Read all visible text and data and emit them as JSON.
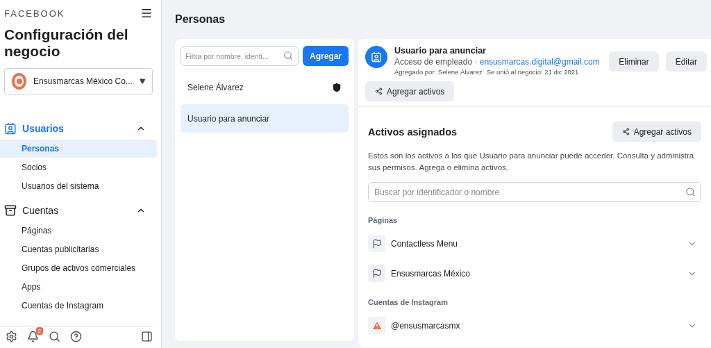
{
  "sidebar": {
    "brand": "FACEBOOK",
    "title": "Configuración del negocio",
    "business": "Ensusmarcas México Co...",
    "sections": [
      {
        "label": "Usuarios",
        "kind": "users",
        "selected": true,
        "expanded": true,
        "items": [
          {
            "label": "Personas",
            "selected": true
          },
          {
            "label": "Socios",
            "selected": false
          },
          {
            "label": "Usuarios del sistema",
            "selected": false
          }
        ]
      },
      {
        "label": "Cuentas",
        "kind": "accounts",
        "selected": false,
        "expanded": true,
        "items": [
          {
            "label": "Páginas",
            "selected": false
          },
          {
            "label": "Cuentas publicitarias",
            "selected": false
          },
          {
            "label": "Grupos de activos comerciales",
            "selected": false
          },
          {
            "label": "Apps",
            "selected": false
          },
          {
            "label": "Cuentas de Instagram",
            "selected": false
          }
        ]
      }
    ],
    "notification_count": "2"
  },
  "page_title": "Personas",
  "people": {
    "filter_placeholder": "Filtra por nombre, identi...",
    "add_button": "Agregar",
    "rows": [
      {
        "name": "Selene Álvarez",
        "admin": true,
        "selected": false
      },
      {
        "name": "Usuario para anunciar",
        "admin": false,
        "selected": true
      }
    ]
  },
  "detail": {
    "name": "Usuario para anunciar",
    "access": "Acceso de empleado ·",
    "email": "ensusmarcas.digital@gmail.com",
    "added_by": "Agregado por: Selene Álvarez",
    "joined": "Se unió al negocio: 21 dic 2021",
    "buttons": [
      "Eliminar",
      "Editar"
    ],
    "add_assets": "Agregar activos"
  },
  "assets": {
    "title": "Activos asignados",
    "add_assets": "Agregar activos",
    "description": "Estos son los activos a los que Usuario para anunciar puede acceder. Consulta y administra sus permisos. Agrega o elimina activos.",
    "search_placeholder": "Buscar por identificador o nombre",
    "groups": [
      {
        "title": "Páginas",
        "items": [
          {
            "name": "Contactless Menu",
            "kind": "page"
          },
          {
            "name": "Ensusmarcas México",
            "kind": "page"
          }
        ]
      },
      {
        "title": "Cuentas de Instagram",
        "items": [
          {
            "name": "@ensusmarcasmx",
            "kind": "warning"
          }
        ]
      }
    ]
  }
}
